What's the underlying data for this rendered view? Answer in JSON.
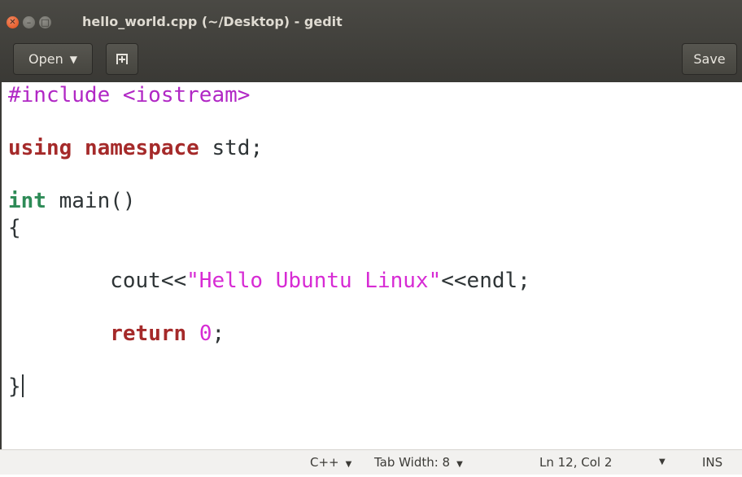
{
  "window": {
    "title": "hello_world.cpp (~/Desktop) - gedit",
    "close_glyph": "✕",
    "minimize_glyph": "–",
    "maximize_glyph": "□"
  },
  "header": {
    "open_label": "Open",
    "open_caret": "▼",
    "save_label": "Save"
  },
  "editor": {
    "lines": [
      [
        {
          "t": "#include <iostream>",
          "c": "preproc"
        }
      ],
      [],
      [
        {
          "t": "using",
          "c": "kw"
        },
        {
          "t": " "
        },
        {
          "t": "namespace",
          "c": "kw"
        },
        {
          "t": " std;"
        }
      ],
      [],
      [
        {
          "t": "int",
          "c": "type"
        },
        {
          "t": " main()"
        }
      ],
      [
        {
          "t": "{"
        }
      ],
      [],
      [
        {
          "t": "        cout<<"
        },
        {
          "t": "\"Hello Ubuntu Linux\"",
          "c": "string"
        },
        {
          "t": "<<endl;"
        }
      ],
      [],
      [
        {
          "t": "        "
        },
        {
          "t": "return",
          "c": "kw"
        },
        {
          "t": " "
        },
        {
          "t": "0",
          "c": "num"
        },
        {
          "t": ";"
        }
      ],
      [],
      [
        {
          "t": "}"
        }
      ]
    ],
    "cursor_line": 11
  },
  "statusbar": {
    "language": "C++",
    "tab_width": "Tab Width: 8",
    "position": "Ln 12, Col 2",
    "dropdown_caret": "▼",
    "mode": "INS"
  },
  "colors": {
    "titlebar": "#3c3b37",
    "close_button": "#df4b16",
    "preprocessor": "#b128c5",
    "string": "#d72bd4",
    "keyword": "#a52a2a",
    "type": "#2e8b57"
  }
}
